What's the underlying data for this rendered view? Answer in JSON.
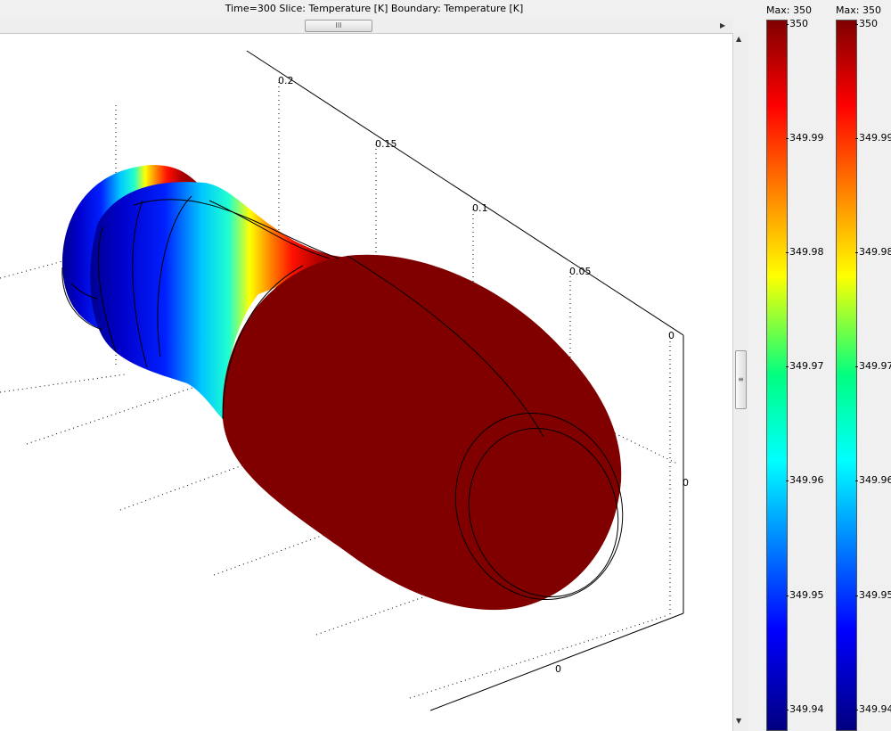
{
  "title": "Time=300   Slice: Temperature [K]   Boundary: Temperature [K]",
  "scroll_thumb_glyph": "III",
  "axis_ticks": {
    "diag": [
      "0.2",
      "0.15",
      "0.1",
      "0.05",
      "0"
    ],
    "right": "0",
    "bottom": "0"
  },
  "colorbars": [
    {
      "max_label": "Max: 350",
      "top_value": "350",
      "ticks": [
        "349.99",
        "349.98",
        "349.97",
        "349.96",
        "349.95",
        "349.94"
      ],
      "colormap": "jet"
    },
    {
      "max_label": "Max: 350",
      "top_value": "350",
      "ticks": [
        "349.99",
        "349.98",
        "349.97",
        "349.96",
        "349.95",
        "349.94"
      ],
      "colormap": "jet"
    }
  ]
}
